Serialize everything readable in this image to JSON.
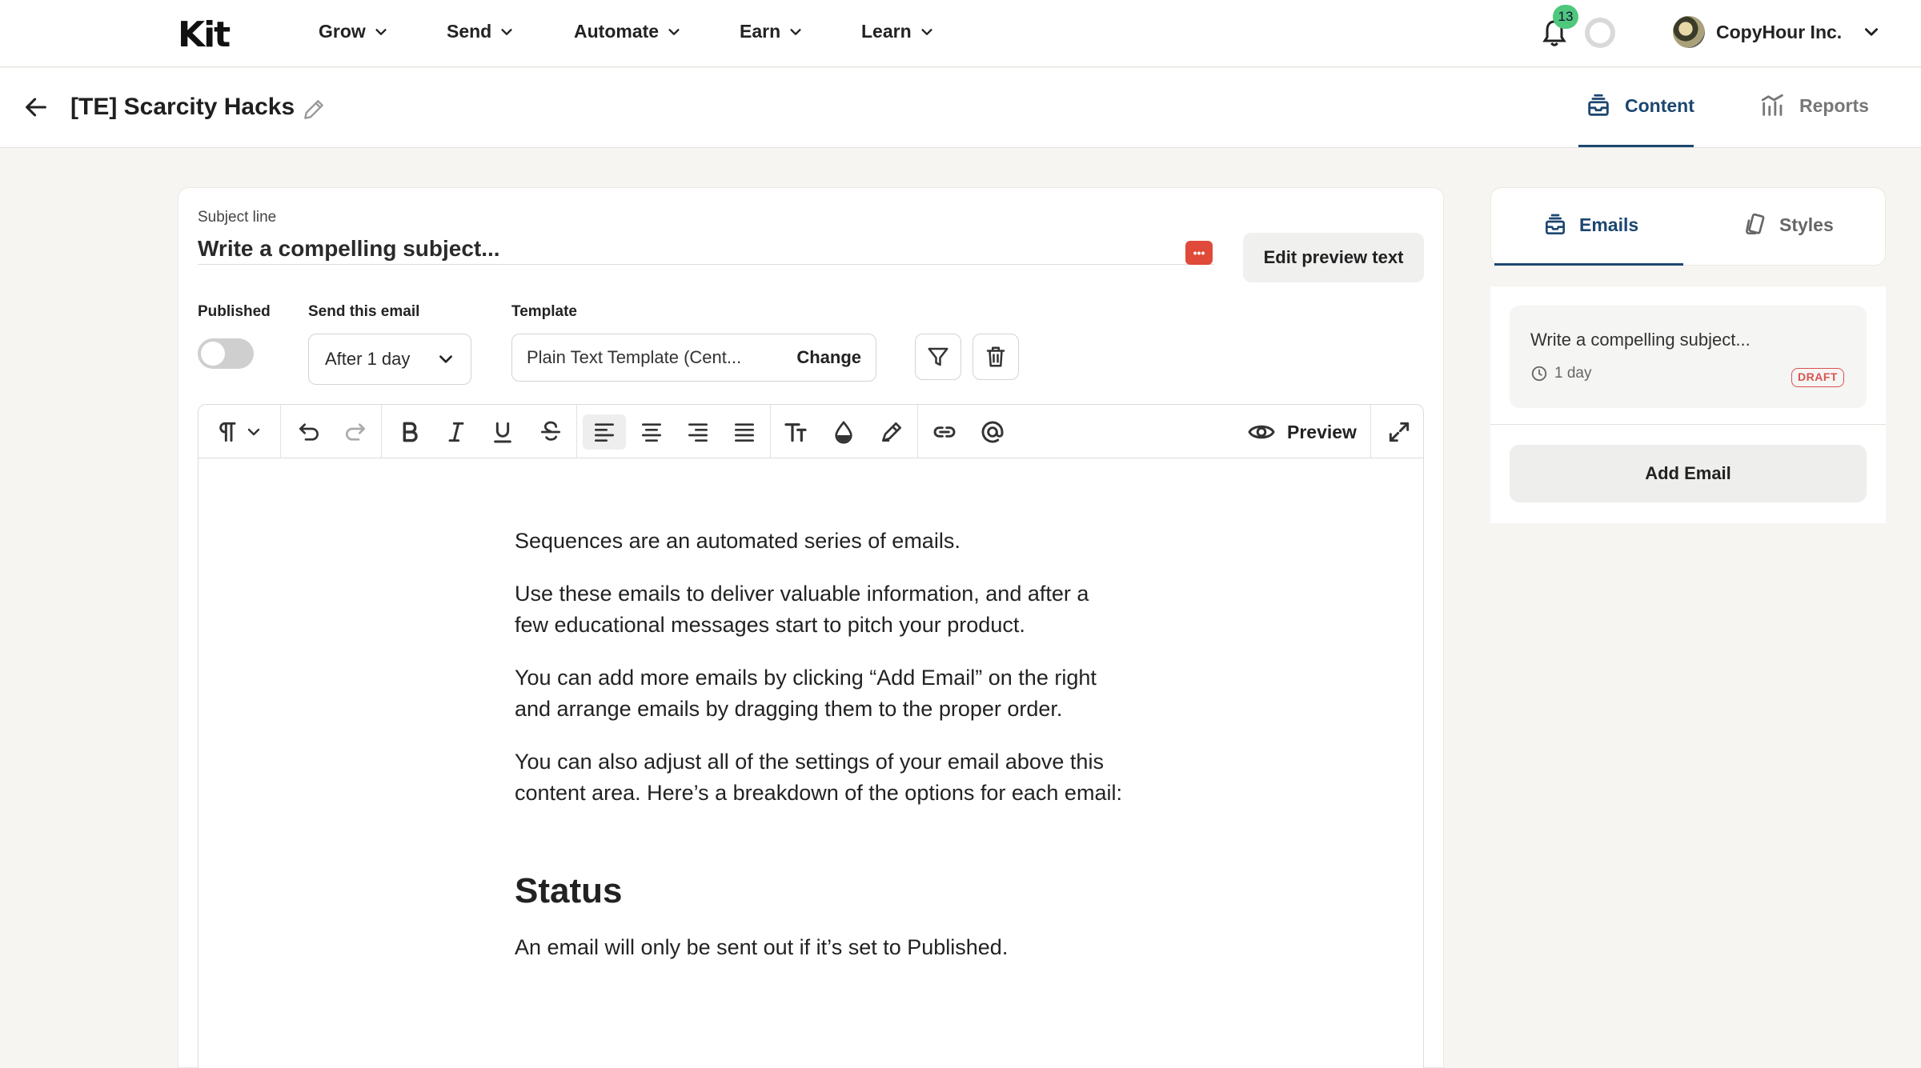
{
  "topnav": {
    "logo": "Kit",
    "items": [
      {
        "label": "Grow"
      },
      {
        "label": "Send"
      },
      {
        "label": "Automate"
      },
      {
        "label": "Earn"
      },
      {
        "label": "Learn"
      }
    ],
    "notifications_count": "13",
    "account_name": "CopyHour Inc."
  },
  "subheader": {
    "title": "[TE] Scarcity Hacks",
    "tabs": [
      {
        "label": "Content",
        "active": true
      },
      {
        "label": "Reports",
        "active": false
      }
    ]
  },
  "editor": {
    "subject_label": "Subject line",
    "subject_placeholder": "Write a compelling subject...",
    "edit_preview_label": "Edit preview text",
    "published_label": "Published",
    "published": false,
    "send_label": "Send this email",
    "send_value": "After 1 day",
    "template_label": "Template",
    "template_value": "Plain Text Template (Cent...",
    "change_label": "Change",
    "preview_label": "Preview"
  },
  "content": {
    "paragraphs": [
      "Sequences are an automated series of emails.",
      "Use these emails to deliver valuable information, and after a few educational messages start to pitch your product.",
      "You can add more emails by clicking “Add Email” on the right and arrange emails by dragging them to the proper order.",
      "You can also adjust all of the settings of your email above this content area. Here’s a breakdown of the options for each email:"
    ],
    "heading": "Status",
    "status_text": "An email will only be sent out if it’s set to Published."
  },
  "sidebar": {
    "tabs": [
      {
        "label": "Emails",
        "active": true
      },
      {
        "label": "Styles",
        "active": false
      }
    ],
    "emails": [
      {
        "subject": "Write a compelling subject...",
        "delay": "1 day",
        "status": "DRAFT"
      }
    ],
    "add_email_label": "Add Email"
  },
  "colors": {
    "accent": "#1c4670",
    "badge_green": "#4fc77c",
    "draft_red": "#d9534f",
    "page_bg": "#f6f5f2"
  }
}
